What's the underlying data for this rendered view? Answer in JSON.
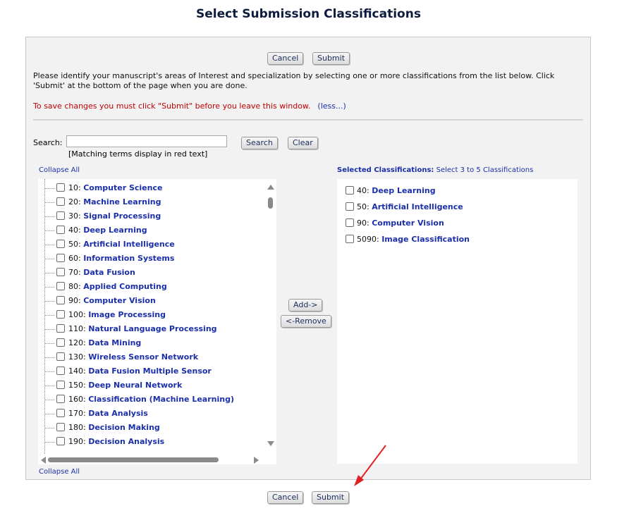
{
  "page": {
    "title": "Select Submission Classifications"
  },
  "top_buttons": {
    "cancel": "Cancel",
    "submit": "Submit"
  },
  "instructions": "Please identify your manuscript's areas of Interest and specialization by selecting one or more classifications from the list below. Click 'Submit' at the bottom of the page when you are done.",
  "warning": "To save changes you must click \"Submit\" before you leave this window.",
  "less_link": "(less...)",
  "search": {
    "label": "Search:",
    "value": "",
    "placeholder": "",
    "search_button": "Search",
    "clear_button": "Clear",
    "note": "[Matching terms display in red text]"
  },
  "tree": {
    "collapse_all_top": "Collapse All",
    "collapse_all_bottom": "Collapse All",
    "items": [
      {
        "code": "10:",
        "name": "Computer Science"
      },
      {
        "code": "20:",
        "name": "Machine Learning"
      },
      {
        "code": "30:",
        "name": "Signal Processing"
      },
      {
        "code": "40:",
        "name": "Deep Learning"
      },
      {
        "code": "50:",
        "name": "Artificial Intelligence"
      },
      {
        "code": "60:",
        "name": "Information Systems"
      },
      {
        "code": "70:",
        "name": "Data Fusion"
      },
      {
        "code": "80:",
        "name": "Applied Computing"
      },
      {
        "code": "90:",
        "name": "Computer Vision"
      },
      {
        "code": "100:",
        "name": "Image Processing"
      },
      {
        "code": "110:",
        "name": "Natural Language Processing"
      },
      {
        "code": "120:",
        "name": "Data Mining"
      },
      {
        "code": "130:",
        "name": "Wireless Sensor Network"
      },
      {
        "code": "140:",
        "name": "Data Fusion Multiple Sensor"
      },
      {
        "code": "150:",
        "name": "Deep Neural Network"
      },
      {
        "code": "160:",
        "name": "Classification (Machine Learning)"
      },
      {
        "code": "170:",
        "name": "Data Analysis"
      },
      {
        "code": "180:",
        "name": "Decision Making"
      },
      {
        "code": "190:",
        "name": "Decision Analysis"
      }
    ]
  },
  "middle_buttons": {
    "add": "Add->",
    "remove": "<-Remove"
  },
  "selected": {
    "header_bold": "Selected Classifications:",
    "header_note": "Select 3 to 5 Classifications",
    "items": [
      {
        "code": "40:",
        "name": "Deep Learning"
      },
      {
        "code": "50:",
        "name": "Artificial Intelligence"
      },
      {
        "code": "90:",
        "name": "Computer Vision"
      },
      {
        "code": "5090:",
        "name": "Image Classification"
      }
    ]
  },
  "bottom_buttons": {
    "cancel": "Cancel",
    "submit": "Submit"
  },
  "colors": {
    "link": "#1b2fa8",
    "warning": "#c00000",
    "panel": "#f2f2f2",
    "annotation_arrow": "#e02020"
  }
}
